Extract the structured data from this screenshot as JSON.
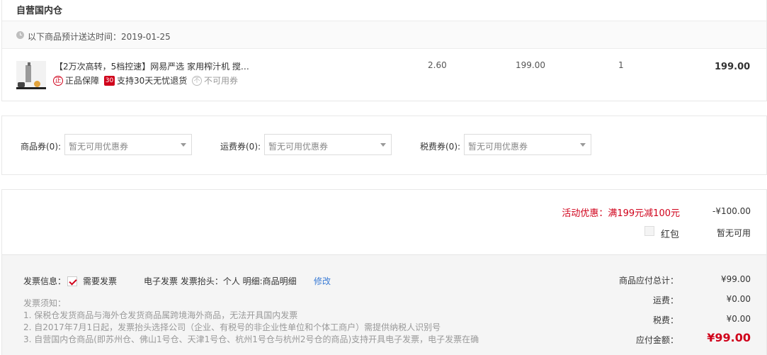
{
  "warehouse": {
    "title": "自营国内仓",
    "delivery_text": "以下商品预计送达时间：2019-01-25"
  },
  "product": {
    "name": "【2万次高转，5档控速】网易严选 家用榨汁机 搅…",
    "tags": [
      {
        "icon": "正",
        "label": "正品保障"
      },
      {
        "icon": "30",
        "label": "支持30天无忧退货"
      },
      {
        "icon": "不",
        "label": "不可用券"
      }
    ],
    "weight": "2.60",
    "price": "199.00",
    "quantity": "1",
    "subtotal": "199.00"
  },
  "coupons": {
    "goods_label": "商品券(0):",
    "goods_placeholder": "暂无可用优惠券",
    "shipping_label": "运费券(0):",
    "shipping_placeholder": "暂无可用优惠券",
    "tax_label": "税费券(0):",
    "tax_placeholder": "暂无可用优惠券"
  },
  "promotion": {
    "label": "活动优惠：满199元减100元",
    "value": "-¥100.00",
    "redpacket_label": "红包",
    "redpacket_value": "暂无可用"
  },
  "invoice": {
    "info_label": "发票信息：",
    "need_label": "需要发票",
    "detail": "电子发票   发票抬头：个人   明细:商品明细",
    "edit_label": "修改",
    "notes_title": "发票须知：",
    "notes": [
      "1. 保税仓发货商品与海外仓发货商品属跨境海外商品，无法开具国内发票",
      "2. 自2017年7月1日起，发票抬头选择公司（企业、有税号的非企业性单位和个体工商户）需提供纳税人识别号",
      "3. 自营国内仓商品(即苏州仓、佛山1号仓、天津1号仓、杭州1号仓与杭州2号仓的商品)支持开具电子发票，电子发票在确"
    ]
  },
  "summary": {
    "goods_total_label": "商品应付总计：",
    "goods_total_value": "¥99.00",
    "shipping_label": "运费：",
    "shipping_value": "¥0.00",
    "tax_label": "税费：",
    "tax_value": "¥0.00",
    "payable_label": "应付金额：",
    "payable_value": "¥99.00"
  },
  "colors": {
    "accent_red": "#d0021b",
    "link_blue": "#3a7bd5"
  }
}
